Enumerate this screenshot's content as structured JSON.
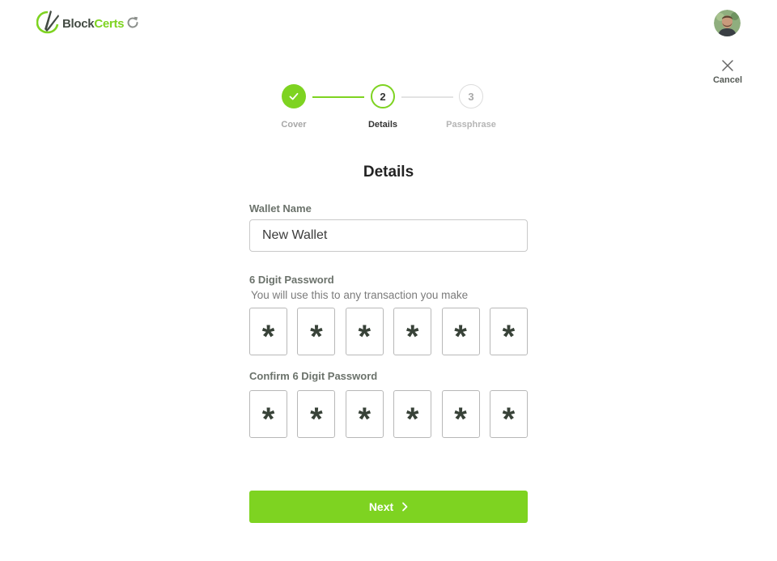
{
  "header": {
    "logo_text_part1": "Block",
    "logo_text_part2": "Certs",
    "brand_color": "#7ed321",
    "logo_icon": "blockcerts-leaf-icon",
    "refresh_icon": "refresh-icon",
    "avatar_icon": "user-avatar",
    "cancel_icon": "close-icon",
    "cancel_label": "Cancel"
  },
  "stepper": {
    "steps": [
      {
        "number": "1",
        "label": "Cover",
        "state": "completed",
        "icon": "check-icon"
      },
      {
        "number": "2",
        "label": "Details",
        "state": "active"
      },
      {
        "number": "3",
        "label": "Passphrase",
        "state": "pending"
      }
    ],
    "progress_color": "#7ed321",
    "pending_color": "#e3e3e3"
  },
  "form": {
    "title": "Details",
    "wallet_name_label": "Wallet Name",
    "wallet_name_value": "New Wallet",
    "password_label": "6 Digit Password",
    "password_hint": "You will use this to any transaction you make",
    "password_digits": [
      "*",
      "*",
      "*",
      "*",
      "*",
      "*"
    ],
    "confirm_label": "Confirm 6 Digit Password",
    "confirm_digits": [
      "*",
      "*",
      "*",
      "*",
      "*",
      "*"
    ],
    "next_label": "Next",
    "next_icon": "chevron-right-icon"
  }
}
